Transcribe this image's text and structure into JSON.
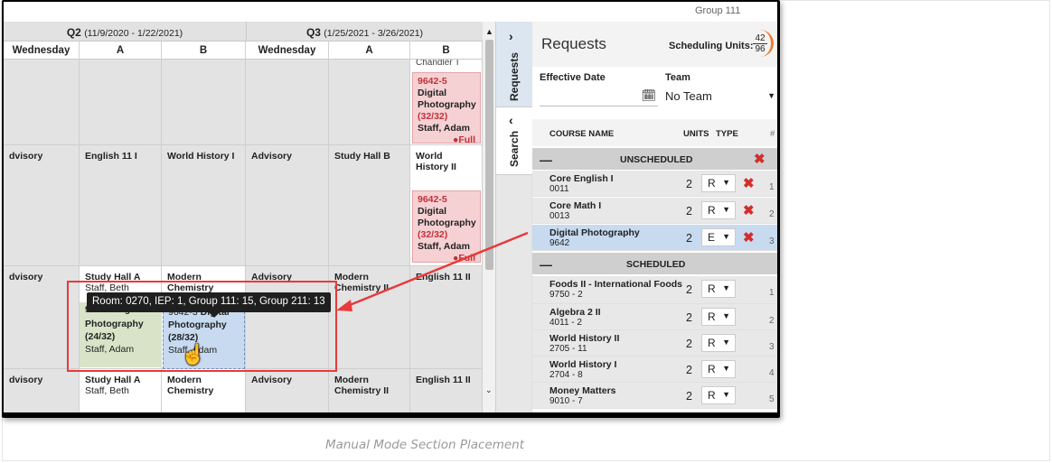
{
  "top_partial_text": "Group 111",
  "quarters": [
    {
      "name": "Q2",
      "range": "(11/9/2020 - 1/22/2021)"
    },
    {
      "name": "Q3",
      "range": "(1/25/2021 - 3/26/2021)"
    }
  ],
  "columns": [
    "Wednesday",
    "A",
    "B",
    "Wednesday",
    "A",
    "B"
  ],
  "grid": {
    "row1_top_partial": "Chandler T",
    "full_box": {
      "code": "9642-5",
      "course": "Digital Photography",
      "count": "(32/32)",
      "teacher": "Staff, Adam",
      "status": "Full"
    },
    "row2": [
      "dvisory",
      "English 11 I",
      "World History I",
      "Advisory",
      "Study Hall B",
      "World History II"
    ],
    "row3": [
      "dvisory",
      "Study Hall A",
      "Modern Chemistry",
      "Advisory",
      "Modern Chemistry II",
      "English 11 II"
    ],
    "row3_sub": [
      "",
      "Staff, Beth",
      "",
      "",
      "",
      ""
    ],
    "green_box": {
      "code_partial": "9642-2 Digital",
      "course_partial": "Photography",
      "count": "(24/32)",
      "teacher": "Staff, Adam"
    },
    "blue_box": {
      "code": "9642-3",
      "course": "Digital Photography",
      "count": "(28/32)",
      "teacher": "Staff, Adam"
    },
    "row4": [
      "dvisory",
      "Study Hall A",
      "Modern Chemistry",
      "Advisory",
      "Modern Chemistry II",
      "English 11 II"
    ],
    "row4_sub": [
      "",
      "Staff, Beth",
      "",
      "",
      "",
      ""
    ]
  },
  "tooltip": "Room: 0270, IEP: 1, Group 111: 15, Group 211: 13",
  "tabs": {
    "requests": "Requests",
    "search": "Search"
  },
  "panel": {
    "title": "Requests",
    "scheduling_units_label": "Scheduling Units:",
    "units_used": "42",
    "units_total": "96",
    "effective_date_label": "Effective Date",
    "team_label": "Team",
    "team_value": "No Team",
    "headers": {
      "course": "COURSE NAME",
      "units": "UNITS",
      "type": "TYPE",
      "num": "#"
    },
    "unscheduled_label": "UNSCHEDULED",
    "scheduled_label": "SCHEDULED",
    "unscheduled": [
      {
        "name": "Core English I",
        "num": "0011",
        "units": "2",
        "type": "R",
        "idx": "1"
      },
      {
        "name": "Core Math I",
        "num": "0013",
        "units": "2",
        "type": "R",
        "idx": "2"
      },
      {
        "name": "Digital Photography",
        "num": "9642",
        "units": "2",
        "type": "E",
        "idx": "3"
      }
    ],
    "scheduled": [
      {
        "name": "Foods II - International Foods",
        "num": "9750 - 2",
        "units": "2",
        "type": "R",
        "idx": "1"
      },
      {
        "name": "Algebra 2 II",
        "num": "4011 - 2",
        "units": "2",
        "type": "R",
        "idx": "2"
      },
      {
        "name": "World History II",
        "num": "2705 - 11",
        "units": "2",
        "type": "R",
        "idx": "3"
      },
      {
        "name": "World History I",
        "num": "2704 - 8",
        "units": "2",
        "type": "R",
        "idx": "4"
      },
      {
        "name": "Money Matters",
        "num": "9010 - 7",
        "units": "2",
        "type": "R",
        "idx": "5"
      }
    ]
  },
  "caption": "Manual Mode Section Placement",
  "colors": {
    "full_red": "#c0313a",
    "highlight_red": "#e8393b",
    "selected_blue": "#c7daf0",
    "units_ring": "#f07a2d"
  }
}
